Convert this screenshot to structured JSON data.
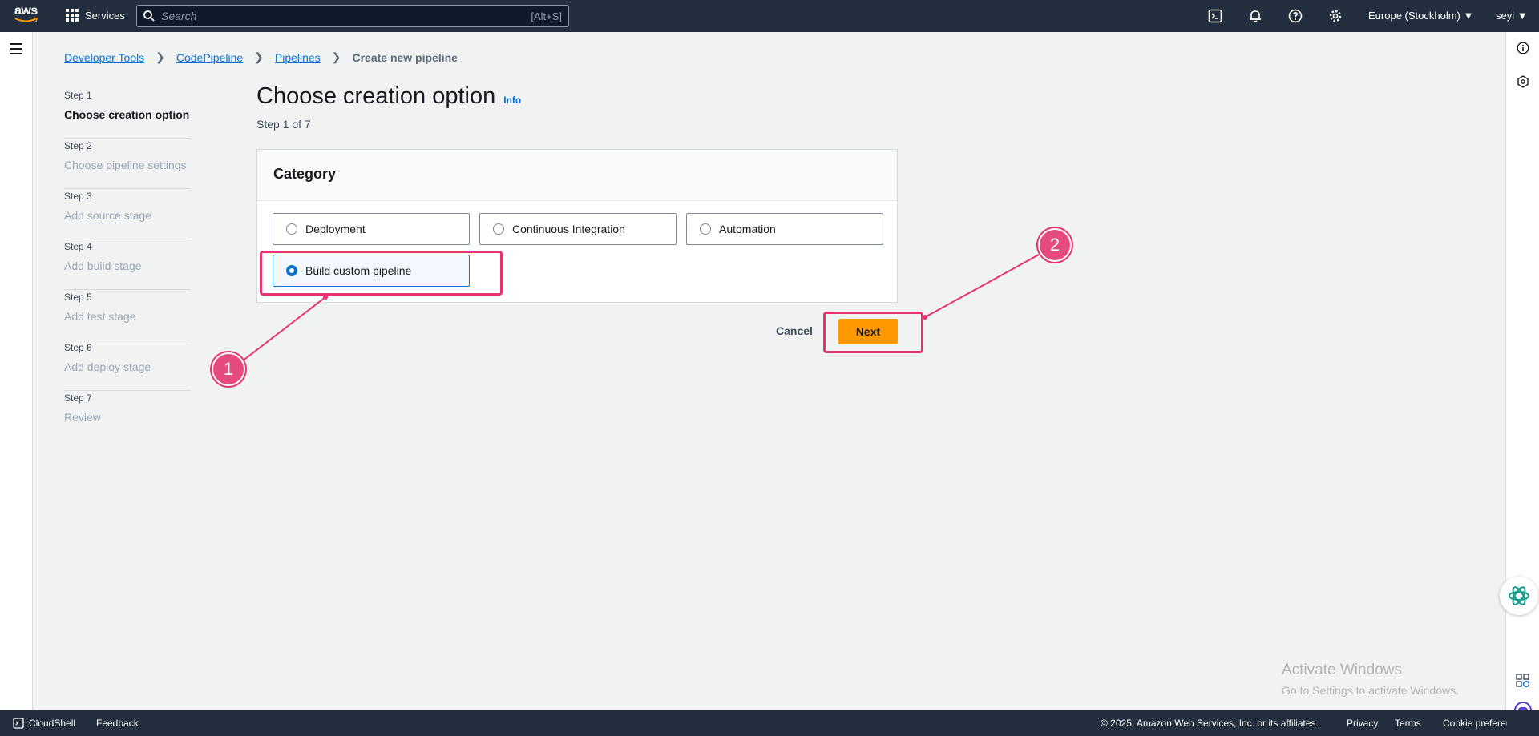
{
  "topnav": {
    "logo_text": "aws",
    "services_label": "Services",
    "search_placeholder": "Search",
    "search_shortcut": "[Alt+S]",
    "region": "Europe (Stockholm) ▼",
    "user": "seyi ▼"
  },
  "breadcrumb": {
    "items": [
      "Developer Tools",
      "CodePipeline",
      "Pipelines"
    ],
    "current": "Create new pipeline"
  },
  "steps": [
    {
      "num": "Step 1",
      "name": "Choose creation option"
    },
    {
      "num": "Step 2",
      "name": "Choose pipeline settings"
    },
    {
      "num": "Step 3",
      "name": "Add source stage"
    },
    {
      "num": "Step 4",
      "name": "Add build stage"
    },
    {
      "num": "Step 5",
      "name": "Add test stage"
    },
    {
      "num": "Step 6",
      "name": "Add deploy stage"
    },
    {
      "num": "Step 7",
      "name": "Review"
    }
  ],
  "page": {
    "title": "Choose creation option",
    "info": "Info",
    "subtitle": "Step 1 of 7"
  },
  "category": {
    "heading": "Category",
    "options": [
      "Deployment",
      "Continuous Integration",
      "Automation",
      "Build custom pipeline"
    ],
    "selected": "Build custom pipeline"
  },
  "actions": {
    "cancel": "Cancel",
    "next": "Next"
  },
  "annotations": {
    "marker1": "1",
    "marker2": "2",
    "color": "#e8336f"
  },
  "watermark": {
    "line1": "Activate Windows",
    "line2": "Go to Settings to activate Windows."
  },
  "footer": {
    "cloudshell": "CloudShell",
    "feedback": "Feedback",
    "copyright": "© 2025, Amazon Web Services, Inc. or its affiliates.",
    "privacy": "Privacy",
    "terms": "Terms",
    "cookie": "Cookie preferences"
  },
  "colors": {
    "nav_bg": "#232f3e",
    "link": "#0972d3",
    "primary_button": "#ff9900"
  }
}
